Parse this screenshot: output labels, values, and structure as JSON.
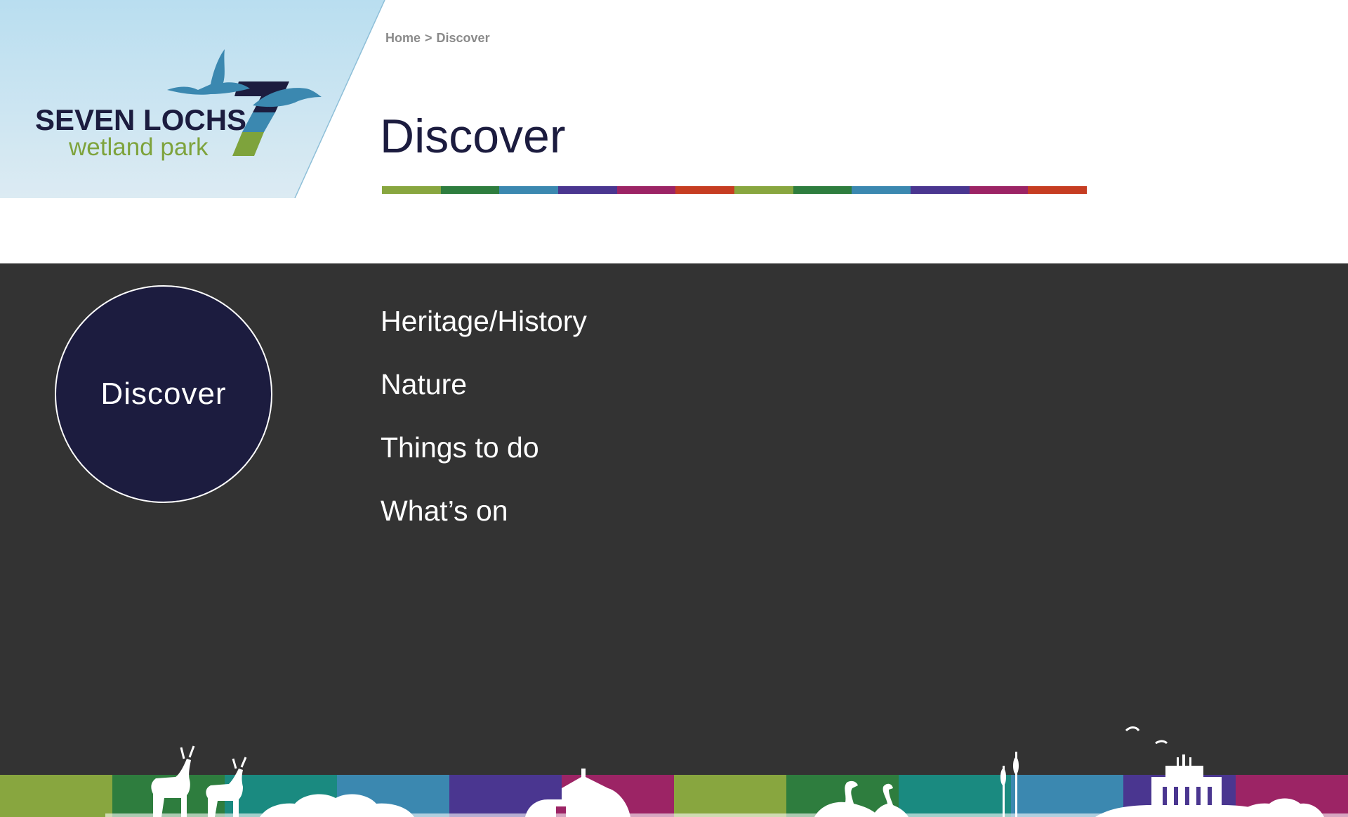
{
  "logo": {
    "title": "SEVEN LOCHS",
    "subtitle": "wetland park",
    "icon": "swan-icon"
  },
  "breadcrumb": {
    "home": "Home",
    "separator": ">",
    "current": "Discover"
  },
  "page": {
    "title": "Discover",
    "stripe_colors": [
      "#88a63f",
      "#2e7d3e",
      "#3b88b0",
      "#4a3690",
      "#9c2465",
      "#c63d22",
      "#88a63f",
      "#2e7d3e",
      "#3b88b0",
      "#4a3690",
      "#9c2465",
      "#c63d22"
    ]
  },
  "section": {
    "circle_label": "Discover"
  },
  "menu": {
    "items": [
      {
        "label": "Heritage/History"
      },
      {
        "label": "Nature"
      },
      {
        "label": "Things to do"
      },
      {
        "label": "What’s on"
      }
    ]
  },
  "footer": {
    "band_colors": [
      "#88a63f",
      "#2e7d3e",
      "#1a8a80",
      "#3b88b0",
      "#4a3690",
      "#9c2465",
      "#88a63f",
      "#2e7d3e",
      "#1a8a80",
      "#3b88b0",
      "#4a3690",
      "#9c2465"
    ]
  },
  "colors": {
    "navy": "#1c1c3f",
    "green": "#7ea33c",
    "dark_bg": "#333333"
  }
}
